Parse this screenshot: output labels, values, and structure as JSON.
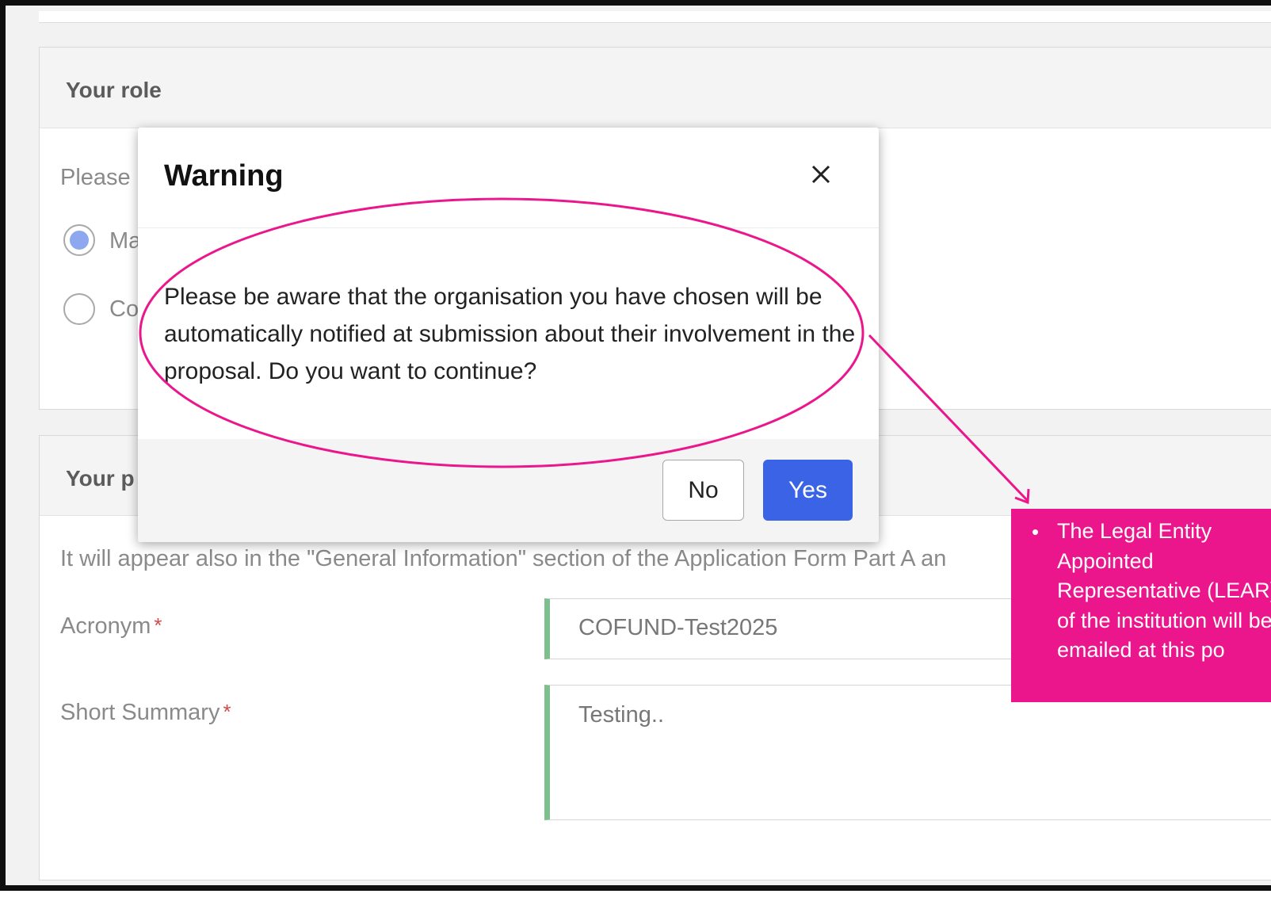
{
  "role_section": {
    "title": "Your role",
    "prompt_fragment": "Please",
    "option_main_fragment": "Ma",
    "option_co_fragment": "Co"
  },
  "project_section": {
    "title_fragment": "Your p",
    "info_text": "It will appear also in the \"General Information\" section of the Application Form Part A an",
    "acronym_label": "Acronym",
    "acronym_value": "COFUND-Test2025",
    "summary_label": "Short Summary",
    "summary_value": "Testing..",
    "required_marker": "*"
  },
  "modal": {
    "title": "Warning",
    "message": "Please be aware that the organisation you have chosen will be automatically notified at submission about their involvement in the proposal. Do you want to continue?",
    "no_label": "No",
    "yes_label": "Yes",
    "close_icon": "close-icon"
  },
  "annotation": {
    "bullet": "•",
    "text": "The Legal Entity Appointed Representative (LEAR) of the institution will be emailed at this po",
    "color": "#ec168c"
  },
  "colors": {
    "accent_button": "#3a63e6",
    "field_valid_border": "#7ec08d",
    "radio_selected": "#8ea8ef",
    "annotation": "#ec168c"
  }
}
